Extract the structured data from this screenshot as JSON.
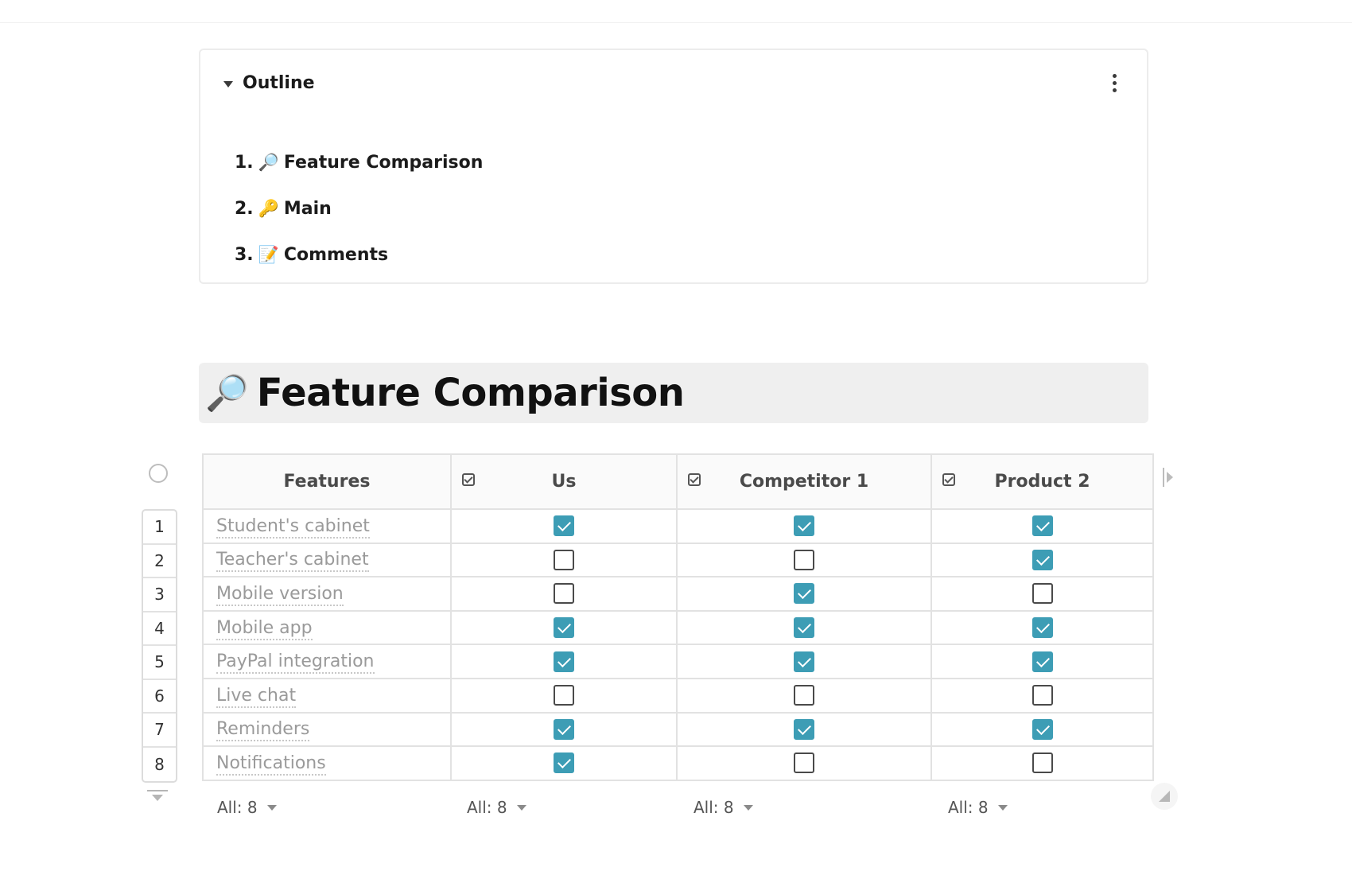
{
  "outline": {
    "title": "Outline",
    "items": [
      {
        "num": "1.",
        "emoji": "🔎",
        "label": "Feature Comparison"
      },
      {
        "num": "2.",
        "emoji": "🔑",
        "label": "Main"
      },
      {
        "num": "3.",
        "emoji": "📝",
        "label": "Comments"
      }
    ]
  },
  "section": {
    "emoji": "🔎",
    "title": "Feature Comparison"
  },
  "table": {
    "columns": [
      {
        "label": "Features",
        "type": "text"
      },
      {
        "label": "Us",
        "type": "checkbox"
      },
      {
        "label": "Competitor 1",
        "type": "checkbox"
      },
      {
        "label": "Product 2",
        "type": "checkbox"
      }
    ],
    "rows": [
      {
        "num": "1",
        "feature": "Student's cabinet",
        "us": true,
        "competitor1": true,
        "product2": true
      },
      {
        "num": "2",
        "feature": "Teacher's cabinet",
        "us": false,
        "competitor1": false,
        "product2": true
      },
      {
        "num": "3",
        "feature": "Mobile version",
        "us": false,
        "competitor1": true,
        "product2": false
      },
      {
        "num": "4",
        "feature": "Mobile app",
        "us": true,
        "competitor1": true,
        "product2": true
      },
      {
        "num": "5",
        "feature": "PayPal integration",
        "us": true,
        "competitor1": true,
        "product2": true
      },
      {
        "num": "6",
        "feature": "Live chat",
        "us": false,
        "competitor1": false,
        "product2": false
      },
      {
        "num": "7",
        "feature": "Reminders",
        "us": true,
        "competitor1": true,
        "product2": true
      },
      {
        "num": "8",
        "feature": "Notifications",
        "us": true,
        "competitor1": false,
        "product2": false
      }
    ],
    "aggregates": [
      "All: 8",
      "All: 8",
      "All: 8",
      "All: 8"
    ]
  },
  "colors": {
    "checkbox_checked": "#3d9db5",
    "header_band": "#efefef"
  }
}
